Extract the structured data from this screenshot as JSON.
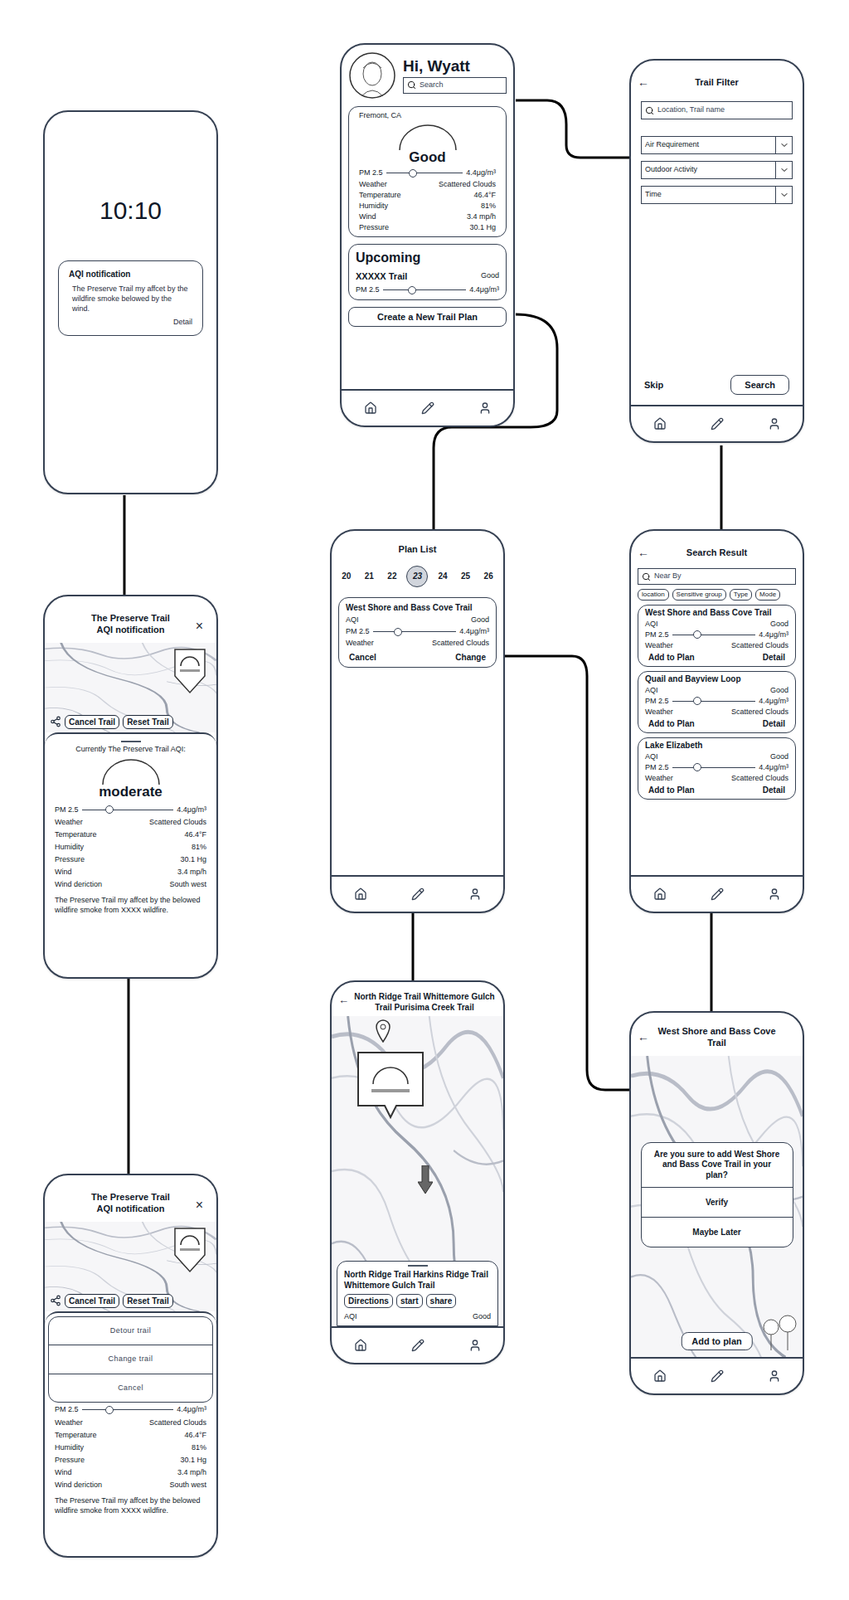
{
  "lock_screen": {
    "time": "10:10",
    "notification": {
      "title": "AQI notification",
      "body": "The Preserve Trail my affcet by the wildfire smoke belowed by the wind.",
      "link": "Detail"
    }
  },
  "aqi_notification": {
    "title_lines": [
      "The Preserve Trail",
      "AQI notification"
    ],
    "close": "×",
    "actions": [
      "Cancel Trail",
      "Reset Trail"
    ],
    "current": "Currently The Preserve Trail AQI:",
    "status": "moderate",
    "pm": {
      "label": "PM 2.5",
      "value": "4.4μg/m³",
      "level": 0.3
    },
    "rows": [
      {
        "label": "Weather",
        "value": "Scattered Clouds"
      },
      {
        "label": "Temperature",
        "value": "46.4°F"
      },
      {
        "label": "Humidity",
        "value": "81%"
      },
      {
        "label": "Pressure",
        "value": "30.1 Hg"
      },
      {
        "label": "Wind",
        "value": "3.4 mp/h"
      },
      {
        "label": "Wind deriction",
        "value": "South west"
      }
    ],
    "note": "The Preserve Trail my affcet by the belowed wildfire smoke from XXXX wildfire."
  },
  "aqi_options": {
    "title_lines": [
      "The Preserve Trail",
      "AQI notification"
    ],
    "close": "×",
    "actions": [
      "Cancel Trail",
      "Reset Trail"
    ],
    "menu": [
      "Detour trail",
      "Change trail",
      "Cancel"
    ],
    "pm": {
      "label": "PM 2.5",
      "value": "4.4μg/m³",
      "level": 0.3
    },
    "rows": [
      {
        "label": "Weather",
        "value": "Scattered Clouds"
      },
      {
        "label": "Temperature",
        "value": "46.4°F"
      },
      {
        "label": "Humidity",
        "value": "81%"
      },
      {
        "label": "Pressure",
        "value": "30.1 Hg"
      },
      {
        "label": "Wind",
        "value": "3.4 mp/h"
      },
      {
        "label": "Wind deriction",
        "value": "South west"
      }
    ],
    "note": "The Preserve Trail my affcet by the belowed wildfire smoke from XXXX wildfire."
  },
  "home": {
    "greeting": "Hi, Wyatt",
    "search": "Search",
    "location": "Fremont, CA",
    "status": "Good",
    "pm": {
      "label": "PM 2.5",
      "value": "4.4μg/m³",
      "level": 0.35
    },
    "rows": [
      {
        "label": "Weather",
        "value": "Scattered Clouds"
      },
      {
        "label": "Temperature",
        "value": "46.4°F"
      },
      {
        "label": "Humidity",
        "value": "81%"
      },
      {
        "label": "Wind",
        "value": "3.4 mp/h"
      },
      {
        "label": "Pressure",
        "value": "30.1 Hg"
      }
    ],
    "upcoming": {
      "title": "Upcoming",
      "trail": "XXXXX Trail",
      "aqi": "Good",
      "pm": {
        "label": "PM 2.5",
        "value": "4.4μg/m³",
        "level": 0.35
      }
    },
    "create": "Create a New Trail Plan"
  },
  "trail_filter": {
    "back": "←",
    "title": "Trail Filter",
    "search": "Location, Trail name",
    "dropdowns": [
      "Air Requirement",
      "Outdoor Activity",
      "Time"
    ],
    "skip": "Skip",
    "submit": "Search"
  },
  "plan_list": {
    "title": "Plan List",
    "dates": [
      {
        "label": "20",
        "selected": false
      },
      {
        "label": "21",
        "selected": false
      },
      {
        "label": "22",
        "selected": false
      },
      {
        "label": "23",
        "selected": true
      },
      {
        "label": "24",
        "selected": false
      },
      {
        "label": "25",
        "selected": false
      },
      {
        "label": "26",
        "selected": false
      }
    ],
    "card": {
      "name": "West Shore and Bass Cove Trail",
      "aqi_label": "AQI",
      "aqi": "Good",
      "pm": {
        "label": "PM 2.5",
        "value": "4.4μg/m³",
        "level": 0.3
      },
      "weather_label": "Weather",
      "weather": "Scattered Clouds",
      "actions": [
        "Cancel",
        "Change"
      ]
    }
  },
  "search_result": {
    "back": "←",
    "title": "Search Result",
    "search": "Near By",
    "chips": [
      "location",
      "Sensitive group",
      "Type",
      "Mode"
    ],
    "results": [
      {
        "name": "West Shore and Bass Cove Trail",
        "aqi": "Good",
        "pm": {
          "label": "PM 2.5",
          "value": "4.4μg/m³",
          "level": 0.3
        },
        "weather": "Scattered Clouds"
      },
      {
        "name": "Quail and Bayview Loop",
        "aqi": "Good",
        "pm": {
          "label": "PM 2.5",
          "value": "4.4μg/m³",
          "level": 0.3
        },
        "weather": "Scattered Clouds"
      },
      {
        "name": "Lake Elizabeth",
        "aqi": "Good",
        "pm": {
          "label": "PM 2.5",
          "value": "4.4μg/m³",
          "level": 0.3
        },
        "weather": "Scattered Clouds"
      }
    ],
    "aqi_label": "AQI",
    "weather_label": "Weather",
    "add": "Add to Plan",
    "detail": "Detail"
  },
  "map_screen": {
    "back": "←",
    "title": "North Ridge Trail Whittemore Gulch Trail Purisima Creek Trail",
    "sheet_title": "North Ridge Trail Harkins Ridge Trail Whittemore Gulch Trail",
    "actions": [
      "Directions",
      "start",
      "share"
    ],
    "aqi_label": "AQI",
    "aqi": "Good"
  },
  "confirm": {
    "back": "←",
    "title": "West Shore and Bass Cove Trail",
    "question": "Are you sure to add West Shore and Bass Cove Trail in your plan?",
    "options": [
      "Verify",
      "Maybe Later"
    ],
    "add": "Add to plan"
  }
}
